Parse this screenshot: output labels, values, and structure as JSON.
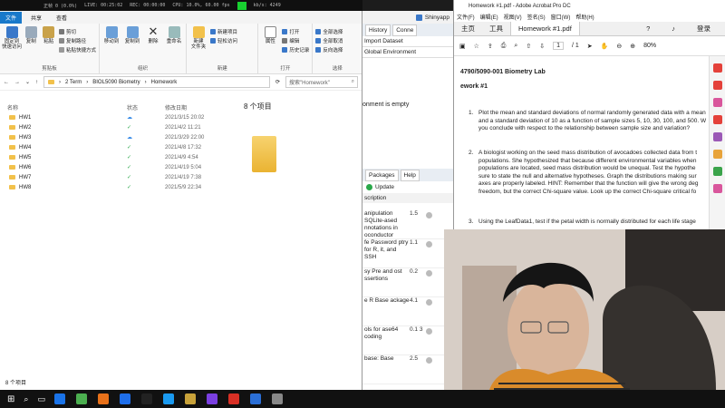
{
  "stats": [
    "正帧 0 (0.0%)",
    "LIVE: 00:25:02",
    "REC: 00:00:00",
    "CPU: 10.0%, 60.00 fps",
    "kb/s: 4249"
  ],
  "explorer": {
    "ribbon_tabs": [
      "文件",
      "共享",
      "查看"
    ],
    "groups": {
      "clipboard": {
        "name": "剪贴板",
        "pin": "固定到\n快速访问",
        "copy": "复制",
        "paste": "粘贴",
        "cut": "剪切",
        "copy_path": "复制路径",
        "paste_shortcut": "粘贴快捷方式"
      },
      "organize": {
        "name": "组织",
        "move_to": "移动到",
        "copy_to": "复制到",
        "delete": "删除",
        "rename": "重命名"
      },
      "new": {
        "name": "新建",
        "new_folder": "新建\n文件夹",
        "new_item": "新建项目",
        "easy_access": "轻松访问"
      },
      "open": {
        "name": "打开",
        "properties": "属性",
        "open": "打开",
        "edit": "编辑",
        "history": "历史记录"
      },
      "select": {
        "name": "选择",
        "select_all": "全部选择",
        "select_none": "全部取消",
        "invert": "反向选择"
      }
    },
    "breadcrumb": [
      "2 Term",
      "BIOL5090 Biometry",
      "Homework"
    ],
    "search_placeholder": "搜索\"Homework\"",
    "columns": {
      "name": "名称",
      "status": "状态",
      "date": "修改日期"
    },
    "files": [
      {
        "name": "HW1",
        "status": "cloud",
        "date": "2021/3/15 20:02"
      },
      {
        "name": "HW2",
        "status": "ok",
        "date": "2021/4/2 11:21"
      },
      {
        "name": "HW3",
        "status": "cloud",
        "date": "2021/3/29 22:00"
      },
      {
        "name": "HW4",
        "status": "ok",
        "date": "2021/4/8 17:32"
      },
      {
        "name": "HW5",
        "status": "ok",
        "date": "2021/4/9 4:54"
      },
      {
        "name": "HW6",
        "status": "ok",
        "date": "2021/4/19 5:04"
      },
      {
        "name": "HW7",
        "status": "ok",
        "date": "2021/4/19 7:38"
      },
      {
        "name": "HW8",
        "status": "ok",
        "date": "2021/5/9 22:34"
      }
    ],
    "preview_count": "8 个项目",
    "status_bar": "8 个项目"
  },
  "rstudio": {
    "top_tabs": [
      "History",
      "Conne"
    ],
    "import_dataset": "Import Dataset",
    "global_env": "Global Environment",
    "empty_msg": "onment is empty",
    "bottom_tabs": [
      "Packages",
      "Help"
    ],
    "update": "Update",
    "desc_header": "scription",
    "packages": [
      {
        "desc": "anipulation SQLite-ased nnotations in oconductor",
        "ver": "1.5"
      },
      {
        "desc": "fe Password ptry for R, it, and SSH",
        "ver": "1.1"
      },
      {
        "desc": "sy Pre and ost ssertions",
        "ver": "0.2"
      },
      {
        "desc": "e R Base ackage",
        "ver": "4.1"
      },
      {
        "desc": "ols for ase64 coding",
        "ver": "0.1 3"
      },
      {
        "desc": "base: Base",
        "ver": "2.5"
      }
    ]
  },
  "acrobat": {
    "window_title": "Homework #1.pdf - Adobe Acrobat Pro DC",
    "menu": [
      "文件(F)",
      "编辑(E)",
      "视图(V)",
      "签名(S)",
      "窗口(W)",
      "帮助(H)"
    ],
    "tabs": {
      "home": "主页",
      "tools": "工具",
      "doc": "Homework #1.pdf",
      "login": "登录"
    },
    "page_current": "1",
    "page_total": "/ 1",
    "zoom": "80%",
    "doc_title": "4790/5090-001 Biometry Lab",
    "doc_subtitle": "ework #1",
    "questions": [
      "Plot the mean and standard deviations of normal randomly generated data with a mean",
      "and a standard deviation of 10 as a function of sample sizes 5, 10, 30, 100, and 500. W",
      "you conclude with respect to the relationship between sample size and variation?",
      "A biologist working on the seed mass distribution of avocadoes collected data from t",
      "populations. She hypothesized that because different environmental variables when",
      "populations are located, seed mass distribution would be unequal. Test the hypothe",
      "sure to state the null and alternative hypotheses. Graph the distributions making sur",
      "axes are properly labeled. HINT: Remember that the function will give the wrong deg",
      "freedom, but the correct Chi-square value. Look up the correct Chi-square critical fo",
      "Using the LeafData1, test if the petal width is normally distributed for each life stage"
    ],
    "q_nums": [
      "1.",
      "2.",
      "3."
    ]
  },
  "taskbar_colors": [
    "#1a73e8",
    "#4caf50",
    "#e8711a",
    "#1f6feb",
    "#222222",
    "#1a9af0",
    "#c8a23a",
    "#7a3fe0",
    "#d93025",
    "#2b6fd6",
    "#888888"
  ],
  "shinyapp": "Shinyapp"
}
